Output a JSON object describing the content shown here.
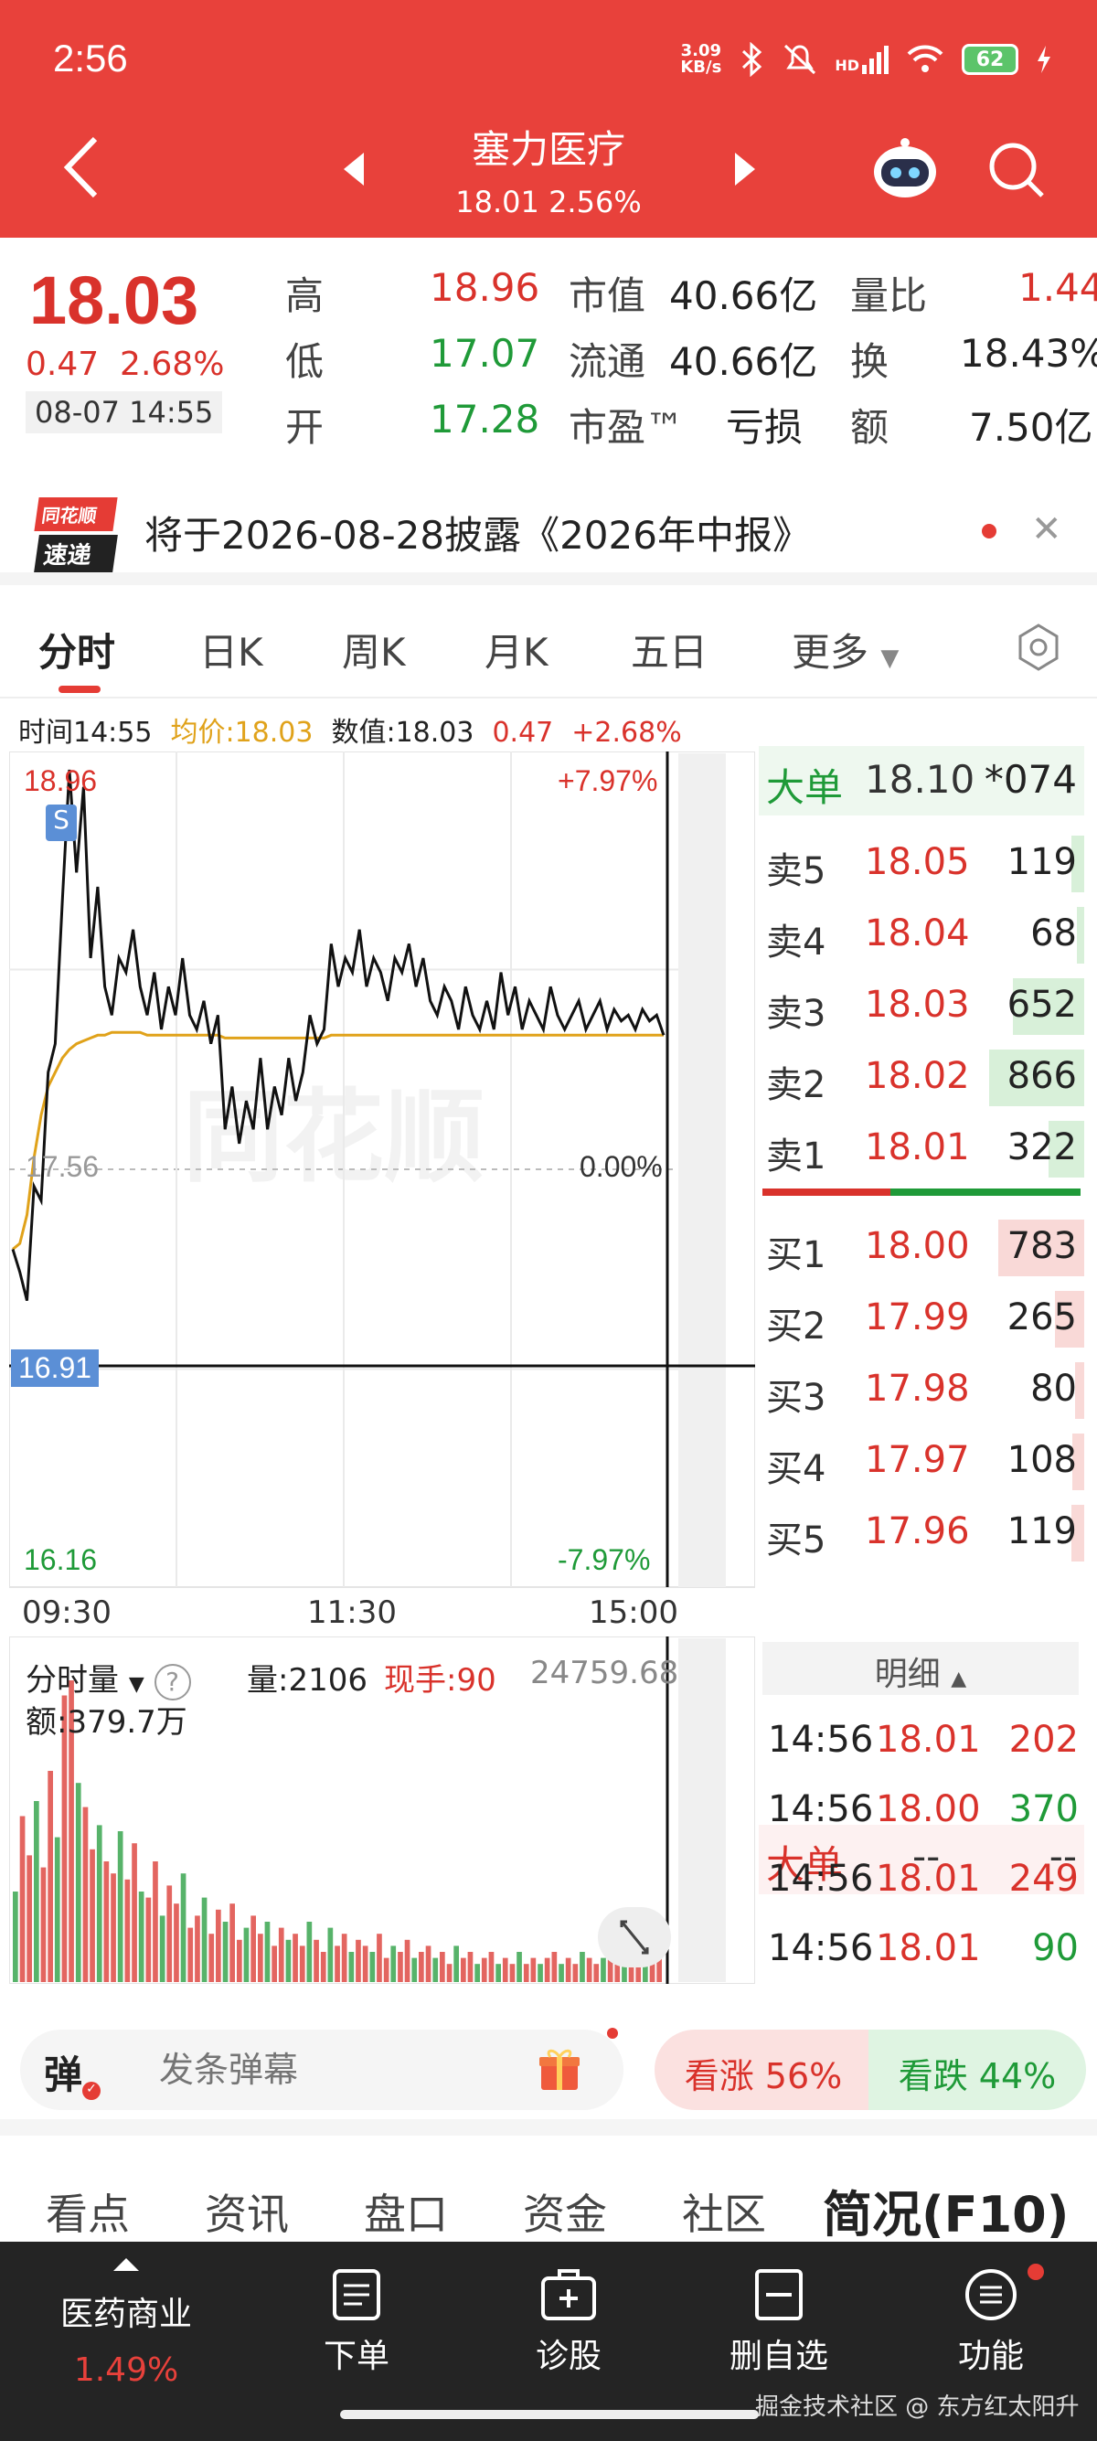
{
  "status_bar": {
    "time": "2:56",
    "net_speed_value": "3.09",
    "net_speed_unit": "KB/s",
    "signal": "HD",
    "battery": "62"
  },
  "header": {
    "title": "塞力医疗",
    "subtitle": "18.01 2.56%"
  },
  "quote": {
    "price": "18.03",
    "change": "0.47",
    "change_pct": "2.68%",
    "datetime": "08-07 14:55",
    "high_label": "高",
    "high": "18.96",
    "low_label": "低",
    "low": "17.07",
    "open_label": "开",
    "open": "17.28",
    "mcap_label": "市值",
    "mcap": "40.66亿",
    "float_label": "流通",
    "float": "40.66亿",
    "pe_label": "市盈™",
    "pe": "亏损",
    "vol_ratio_label": "量比",
    "vol_ratio": "1.44",
    "turnover_label": "换",
    "turnover": "18.43%",
    "amount_label": "额",
    "amount": "7.50亿"
  },
  "notice": {
    "logo_line1": "同花顺",
    "logo_line2": "速递",
    "text": "将于2026-08-28披露《2026年中报》"
  },
  "chart_tabs": [
    "分时",
    "日K",
    "周K",
    "月K",
    "五日",
    "更多"
  ],
  "info_line": {
    "time": "时间14:55",
    "avg": "均价:18.03",
    "value": "数值:18.03",
    "chg": "0.47",
    "chg_pct": "+2.68%"
  },
  "chart_labels": {
    "top_price": "18.96",
    "top_pct": "+7.97%",
    "mid_price": "17.56",
    "mid_pct": "0.00%",
    "cross_price": "16.91",
    "bottom_price": "16.16",
    "bottom_pct": "-7.97%",
    "t_start": "09:30",
    "t_mid": "11:30",
    "t_end": "15:00",
    "marker": "S",
    "watermark": "同花顺"
  },
  "chart_data": {
    "type": "line",
    "ylim": [
      16.16,
      18.96
    ],
    "base_price": 17.56,
    "series": [
      {
        "name": "price",
        "values": [
          17.28,
          17.2,
          17.1,
          17.5,
          17.45,
          17.9,
          18.0,
          18.5,
          18.96,
          18.6,
          18.9,
          18.3,
          18.55,
          18.2,
          18.1,
          18.3,
          18.25,
          18.4,
          18.2,
          18.1,
          18.25,
          18.05,
          18.2,
          18.1,
          18.3,
          18.1,
          18.05,
          18.15,
          18.0,
          18.1,
          17.7,
          17.85,
          17.65,
          17.8,
          17.7,
          17.95,
          17.7,
          17.85,
          17.75,
          17.95,
          17.8,
          17.9,
          18.1,
          18.0,
          18.05,
          18.35,
          18.2,
          18.3,
          18.25,
          18.4,
          18.2,
          18.3,
          18.25,
          18.15,
          18.3,
          18.25,
          18.35,
          18.2,
          18.3,
          18.15,
          18.1,
          18.2,
          18.15,
          18.05,
          18.2,
          18.1,
          18.05,
          18.15,
          18.05,
          18.25,
          18.1,
          18.2,
          18.05,
          18.15,
          18.1,
          18.05,
          18.2,
          18.1,
          18.05,
          18.1,
          18.15,
          18.05,
          18.1,
          18.15,
          18.05,
          18.12,
          18.08,
          18.1,
          18.05,
          18.12,
          18.08,
          18.1,
          18.03
        ]
      },
      {
        "name": "avg",
        "values": [
          17.28,
          17.3,
          17.4,
          17.6,
          17.75,
          17.85,
          17.9,
          17.95,
          17.98,
          18.0,
          18.01,
          18.02,
          18.03,
          18.03,
          18.04,
          18.04,
          18.04,
          18.04,
          18.04,
          18.03,
          18.03,
          18.03,
          18.03,
          18.03,
          18.03,
          18.03,
          18.03,
          18.03,
          18.03,
          18.03,
          18.02,
          18.02,
          18.02,
          18.02,
          18.02,
          18.02,
          18.02,
          18.02,
          18.02,
          18.02,
          18.02,
          18.02,
          18.02,
          18.02,
          18.02,
          18.03,
          18.03,
          18.03,
          18.03,
          18.03,
          18.03,
          18.03,
          18.03,
          18.03,
          18.03,
          18.03,
          18.03,
          18.03,
          18.03,
          18.03,
          18.03,
          18.03,
          18.03,
          18.03,
          18.03,
          18.03,
          18.03,
          18.03,
          18.03,
          18.03,
          18.03,
          18.03,
          18.03,
          18.03,
          18.03,
          18.03,
          18.03,
          18.03,
          18.03,
          18.03,
          18.03,
          18.03,
          18.03,
          18.03,
          18.03,
          18.03,
          18.03,
          18.03,
          18.03,
          18.03,
          18.03,
          18.03,
          18.03
        ]
      }
    ],
    "volume": [
      30,
      55,
      42,
      60,
      38,
      70,
      48,
      95,
      100,
      66,
      58,
      44,
      52,
      40,
      36,
      50,
      34,
      46,
      30,
      28,
      40,
      22,
      32,
      26,
      36,
      18,
      22,
      28,
      16,
      24,
      20,
      26,
      14,
      18,
      22,
      16,
      20,
      12,
      18,
      14,
      16,
      12,
      20,
      14,
      10,
      18,
      12,
      16,
      10,
      14,
      12,
      10,
      16,
      8,
      12,
      10,
      14,
      8,
      10,
      12,
      8,
      10,
      6,
      12,
      8,
      10,
      6,
      8,
      10,
      6,
      8,
      6,
      10,
      6,
      8,
      6,
      8,
      10,
      6,
      8,
      6,
      10,
      8,
      6,
      8,
      10,
      12,
      8,
      10,
      14,
      12,
      16,
      20
    ]
  },
  "order_book": {
    "big_label": "大单",
    "big_price": "18.10",
    "big_vol": "*074",
    "asks": [
      {
        "label": "卖5",
        "price": "18.05",
        "vol": "119"
      },
      {
        "label": "卖4",
        "price": "18.04",
        "vol": "68"
      },
      {
        "label": "卖3",
        "price": "18.03",
        "vol": "652"
      },
      {
        "label": "卖2",
        "price": "18.02",
        "vol": "866"
      },
      {
        "label": "卖1",
        "price": "18.01",
        "vol": "322"
      }
    ],
    "bids": [
      {
        "label": "买1",
        "price": "18.00",
        "vol": "783"
      },
      {
        "label": "买2",
        "price": "17.99",
        "vol": "265"
      },
      {
        "label": "买3",
        "price": "17.98",
        "vol": "80"
      },
      {
        "label": "买4",
        "price": "17.97",
        "vol": "108"
      },
      {
        "label": "买5",
        "price": "17.96",
        "vol": "119"
      }
    ],
    "big2_label": "大单",
    "big2_price": "--",
    "big2_vol": "--"
  },
  "volume_panel": {
    "selector": "分时量",
    "vol": "量:2106",
    "now": "现手:90",
    "max": "24759.68",
    "amount": "额:379.7万"
  },
  "details": {
    "header": "明细",
    "rows": [
      {
        "t": "14:56",
        "p": "18.01",
        "v": "202"
      },
      {
        "t": "14:56",
        "p": "18.00",
        "v": "370"
      },
      {
        "t": "14:56",
        "p": "18.01",
        "v": "249"
      },
      {
        "t": "14:56",
        "p": "18.01",
        "v": "90"
      }
    ]
  },
  "danmaku": {
    "logo": "弹",
    "placeholder": "发条弹幕",
    "rise": "看涨 56%",
    "fall": "看跌 44%"
  },
  "info_tabs": [
    "看点",
    "资讯",
    "盘口",
    "资金",
    "社区",
    "简况(F10)"
  ],
  "bottom_nav": {
    "industry": "医药商业",
    "industry_pct": "1.49%",
    "order": "下单",
    "diagnose": "诊股",
    "remove": "删自选",
    "functions": "功能",
    "watermark": "掘金技术社区 @ 东方红太阳升"
  },
  "colors": {
    "brand": "#e8413b",
    "up": "#d9322b",
    "down": "#1f9a38",
    "avg_line": "#e0a21a"
  }
}
